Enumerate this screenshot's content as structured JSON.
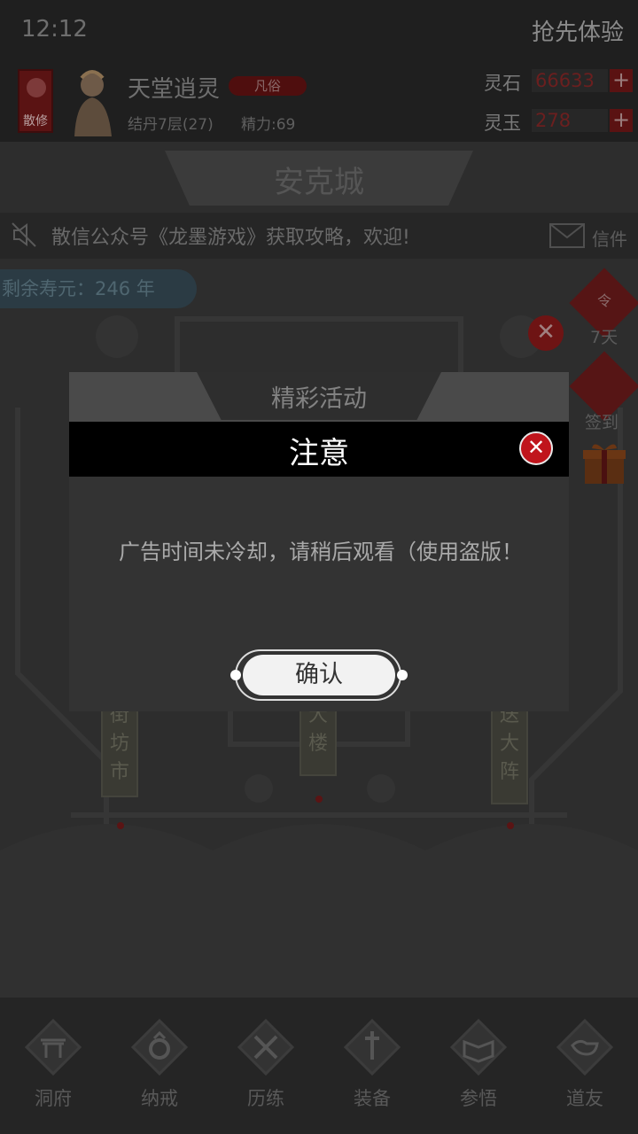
{
  "status_bar": {
    "time": "12:12",
    "early_access": "抢先体验"
  },
  "player": {
    "sect_badge": "散修",
    "name": "天堂逍灵",
    "rank": "凡俗",
    "realm": "结丹7层(27)",
    "stamina": "精力:69"
  },
  "currency": [
    {
      "label": "灵石",
      "value": "66633",
      "add": "+"
    },
    {
      "label": "灵玉",
      "value": "278",
      "add": "+"
    }
  ],
  "map": {
    "city": "安克城",
    "notice": "散信公众号《龙墨游戏》获取攻略，欢迎!",
    "mail_label": "信件",
    "lifespan": "剩余寿元：246 年",
    "close_glyph": "✕",
    "side": [
      {
        "icon_text": "令",
        "label": "7天"
      },
      {
        "icon_text": "",
        "label": "签到"
      },
      {
        "icon_text": "",
        "label": ""
      }
    ],
    "nodes": [
      {
        "label": "街坊市"
      },
      {
        "label": "大楼"
      },
      {
        "label": "送大阵"
      }
    ]
  },
  "modal": {
    "tab_title": "精彩活动",
    "title": "注意",
    "close_glyph": "✕",
    "message": "广告时间未冷却，请稍后观看（使用盗版！",
    "confirm": "确认"
  },
  "nav": [
    {
      "label": "洞府",
      "icon": "gate-icon"
    },
    {
      "label": "纳戒",
      "icon": "ring-icon"
    },
    {
      "label": "历练",
      "icon": "swords-icon"
    },
    {
      "label": "装备",
      "icon": "sword-icon"
    },
    {
      "label": "参悟",
      "icon": "book-icon"
    },
    {
      "label": "道友",
      "icon": "handshake-icon"
    }
  ]
}
